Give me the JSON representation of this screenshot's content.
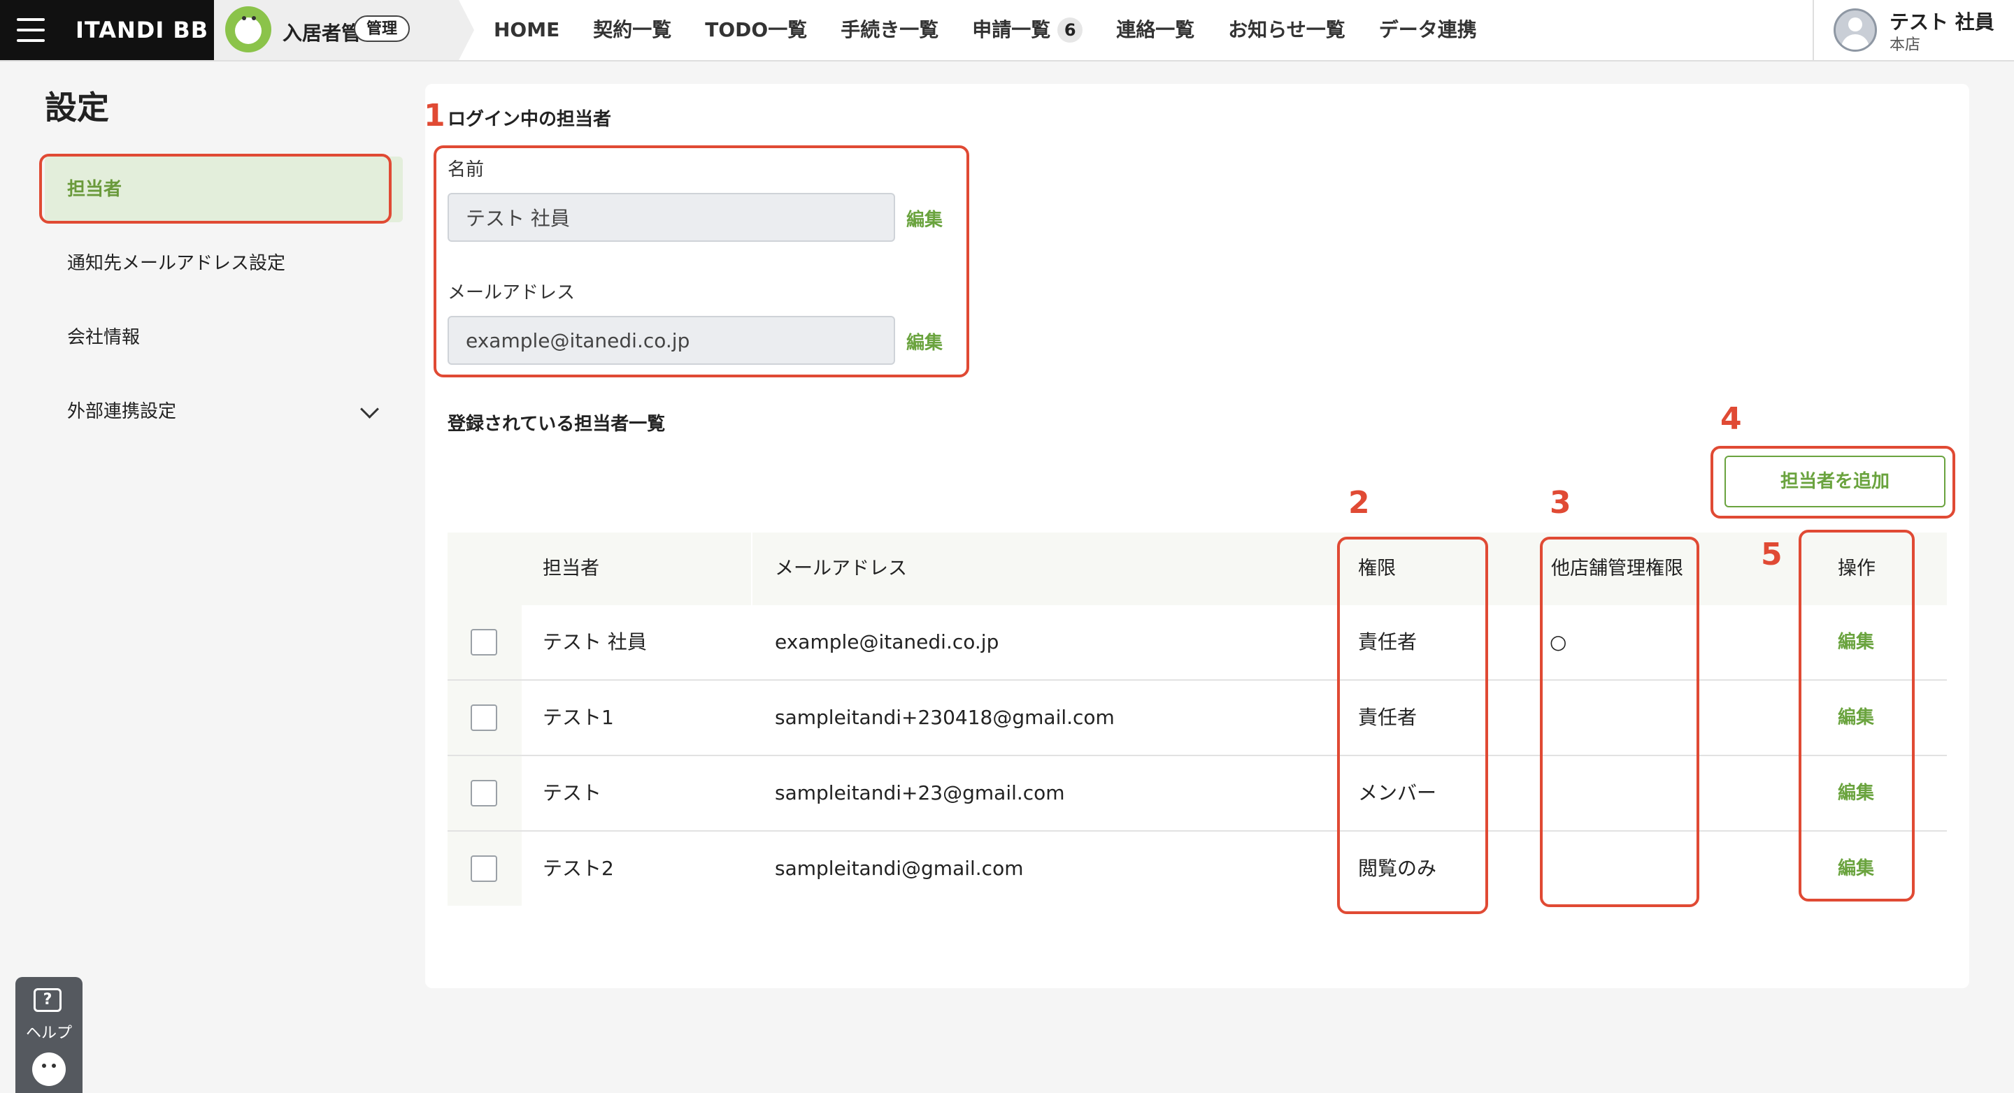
{
  "header": {
    "brand": "ITANDI BB",
    "module_name": "入居者管理",
    "module_badge": "管理",
    "nav": [
      {
        "label": "HOME"
      },
      {
        "label": "契約一覧"
      },
      {
        "label": "TODO一覧"
      },
      {
        "label": "手続き一覧"
      },
      {
        "label": "申請一覧",
        "count": "6"
      },
      {
        "label": "連絡一覧"
      },
      {
        "label": "お知らせ一覧"
      },
      {
        "label": "データ連携"
      }
    ],
    "user_name": "テスト 社員",
    "user_store": "本店"
  },
  "sidebar": {
    "title": "設定",
    "items": [
      {
        "label": "担当者"
      },
      {
        "label": "通知先メールアドレス設定"
      },
      {
        "label": "会社情報"
      },
      {
        "label": "外部連携設定"
      }
    ]
  },
  "login_section": {
    "title": "ログイン中の担当者",
    "name_label": "名前",
    "name_value": "テスト 社員",
    "email_label": "メールアドレス",
    "email_value": "example@itanedi.co.jp",
    "edit_label": "編集"
  },
  "list_section": {
    "title": "登録されている担当者一覧",
    "add_button": "担当者を追加",
    "columns": [
      "担当者",
      "メールアドレス",
      "権限",
      "他店舗管理権限",
      "操作"
    ],
    "rows": [
      {
        "name": "テスト 社員",
        "email": "example@itanedi.co.jp",
        "role": "責任者",
        "other_store": "○",
        "action": "編集"
      },
      {
        "name": "テスト1",
        "email": "sampleitandi+230418@gmail.com",
        "role": "責任者",
        "other_store": "",
        "action": "編集"
      },
      {
        "name": "テスト",
        "email": "sampleitandi+23@gmail.com",
        "role": "メンバー",
        "other_store": "",
        "action": "編集"
      },
      {
        "name": "テスト2",
        "email": "sampleitandi@gmail.com",
        "role": "閲覧のみ",
        "other_store": "",
        "action": "編集"
      }
    ]
  },
  "annotations": [
    "1",
    "2",
    "3",
    "4",
    "5"
  ],
  "help": {
    "label": "ヘルプ",
    "icon": "?"
  },
  "colors": {
    "accent_green": "#6aa33e",
    "annotation_red": "#e04a34",
    "active_bg": "#e3eedb"
  }
}
